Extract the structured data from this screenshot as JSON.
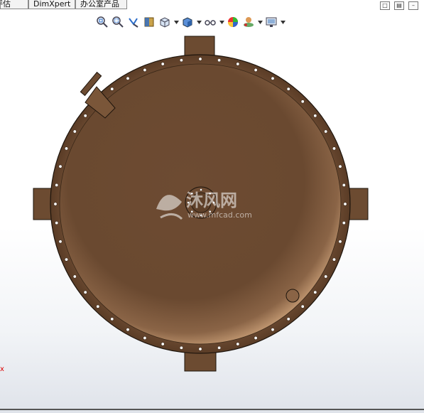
{
  "tabs": [
    {
      "label": "评估"
    },
    {
      "label": "DimXpert"
    },
    {
      "label": "办公室产品"
    }
  ],
  "window_buttons": [
    "restore-icon",
    "tile-icon",
    "close-icon"
  ],
  "toolbar": {
    "buttons": [
      "zoom-to-fit-icon",
      "zoom-area-icon",
      "previous-view-icon",
      "section-view-icon",
      "view-orientation-icon",
      "display-style-icon",
      "hide-show-items-icon",
      "edit-appearance-icon",
      "apply-scene-icon",
      "view-settings-icon"
    ]
  },
  "model": {
    "body_color": "#6b4a30",
    "rim_color": "#7a5638",
    "hole_color": "#ffffff"
  },
  "watermark": {
    "brand": "沐风网",
    "url": "www.mfcad.com"
  },
  "axis_marker": "x"
}
